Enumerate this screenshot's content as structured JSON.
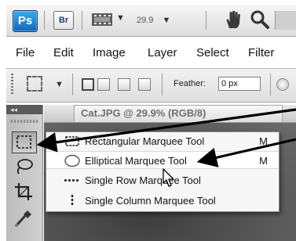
{
  "appbar": {
    "logo_ps": "Ps",
    "logo_br": "Br",
    "zoom_value": "29.9",
    "icons": [
      "film-strip-icon",
      "hand-icon",
      "zoom-magnifier-icon"
    ]
  },
  "menubar": {
    "items": [
      "File",
      "Edit",
      "Image",
      "Layer",
      "Select",
      "Filter"
    ]
  },
  "options": {
    "feather_label": "Feather:",
    "feather_value": "0 px"
  },
  "document": {
    "tab_title": "Cat.JPG @ 29.9% (RGB/8)"
  },
  "toolbox": {
    "collapse_glyph": "◂◂",
    "tools": [
      "rectangular-marquee-tool-icon",
      "lasso-tool-icon",
      "crop-tool-icon",
      "eyedropper-tool-icon"
    ]
  },
  "flyout": {
    "items": [
      {
        "label": "Rectangular Marquee Tool",
        "key": "M",
        "icon": "rectangle-marquee-icon"
      },
      {
        "label": "Elliptical Marquee Tool",
        "key": "M",
        "icon": "ellipse-marquee-icon"
      },
      {
        "label": "Single Row Marquee Tool",
        "key": "",
        "icon": "single-row-marquee-icon"
      },
      {
        "label": "Single Column Marquee Tool",
        "key": "",
        "icon": "single-column-marquee-icon"
      }
    ]
  },
  "colors": {
    "ps_blue": "#1f7ccf",
    "annotation_arrow": "#000000",
    "menu_background": "#f7f7f7"
  }
}
